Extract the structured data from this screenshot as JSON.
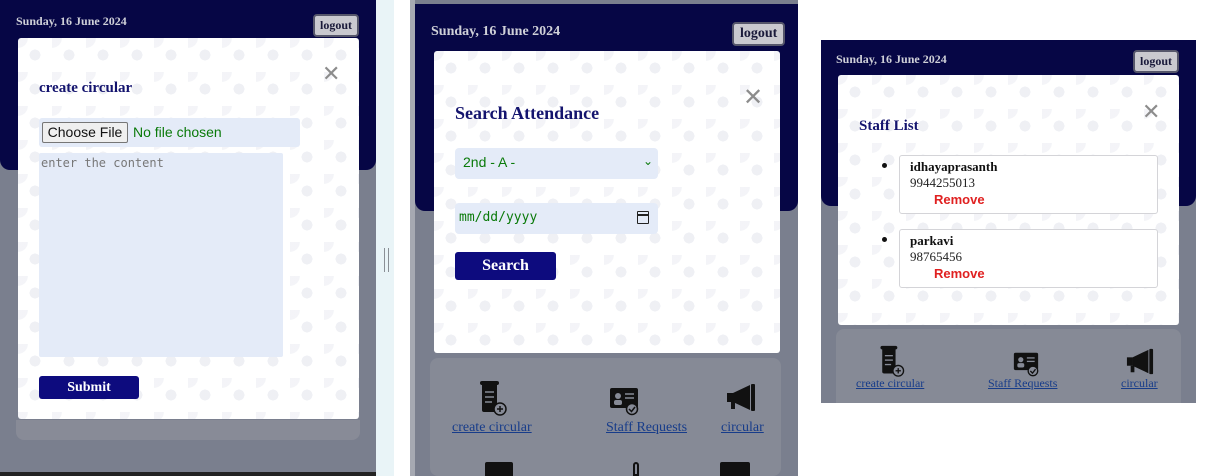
{
  "panel1": {
    "date": "Sunday, 16 June 2024",
    "logout": "logout",
    "modal": {
      "title": "create circular",
      "close": "✕",
      "choose_file": "Choose File",
      "no_file": "No file chosen",
      "content_placeholder": "enter the content",
      "submit": "Submit"
    }
  },
  "panel2": {
    "date": "Sunday, 16 June 2024",
    "logout": "logout",
    "modal": {
      "title": "Search Attendance",
      "close": "✕",
      "class_selected": "2nd - A -",
      "date_placeholder": "mm/dd/yyyy",
      "search": "Search"
    },
    "tiles": [
      {
        "label": "create circular",
        "icon": "create-circular-icon"
      },
      {
        "label": "Staff Requests",
        "icon": "staff-requests-icon"
      },
      {
        "label": "circular",
        "icon": "megaphone-icon"
      }
    ]
  },
  "panel3": {
    "date": "Sunday, 16 June 2024",
    "logout": "logout",
    "modal": {
      "title": "Staff List",
      "close": "✕",
      "staff": [
        {
          "name": "idhayaprasanth",
          "phone": "9944255013",
          "remove": "Remove"
        },
        {
          "name": "parkavi",
          "phone": "98765456",
          "remove": "Remove"
        }
      ]
    },
    "tiles": [
      {
        "label": "create circular",
        "icon": "create-circular-icon"
      },
      {
        "label": "Staff Requests",
        "icon": "staff-requests-icon"
      },
      {
        "label": "circular",
        "icon": "megaphone-icon"
      }
    ]
  },
  "colors": {
    "navy_header": "#060645",
    "button_navy": "#0d0b7e",
    "overlay_gray": "#7a7f8e",
    "input_bg": "#e4ebf8",
    "green_text": "#0a7a0a",
    "remove_red": "#e02121"
  }
}
